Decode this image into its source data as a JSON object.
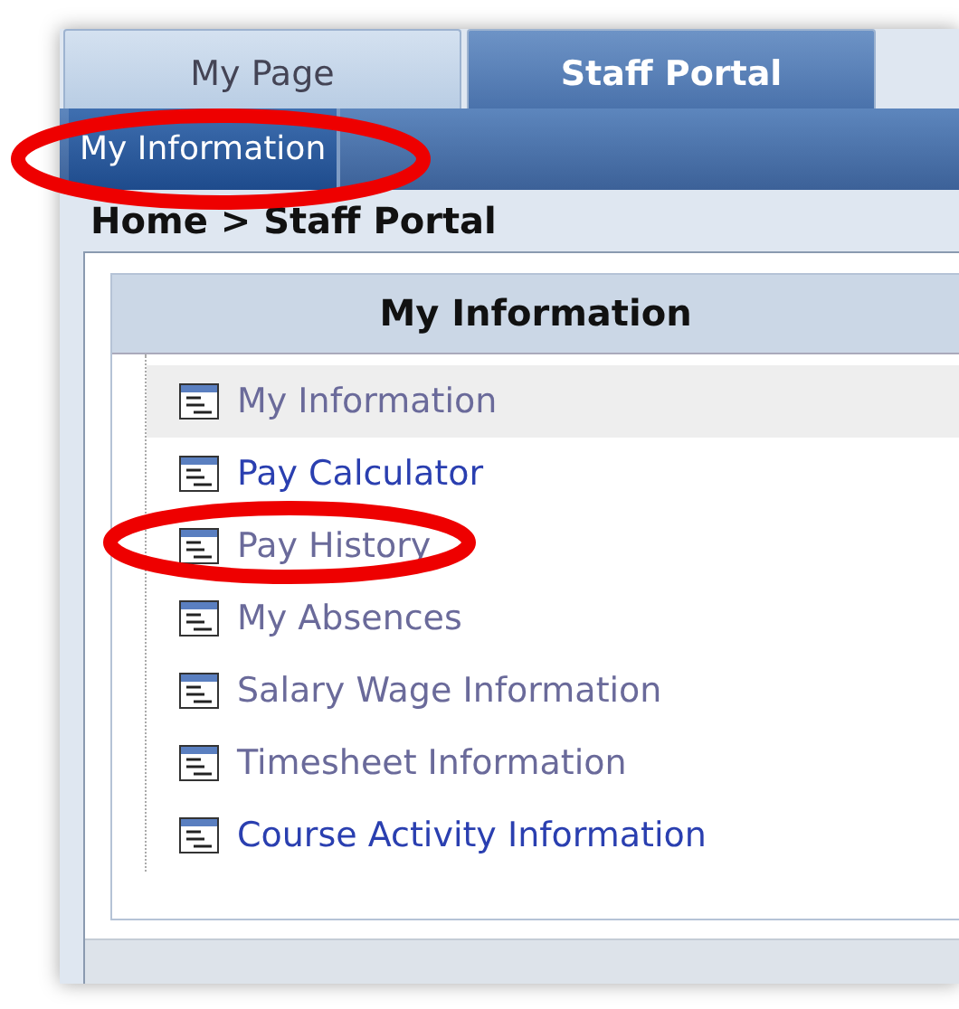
{
  "tabs": [
    {
      "label": "My Page",
      "selected": false
    },
    {
      "label": "Staff Portal",
      "selected": true
    }
  ],
  "subnav": [
    {
      "label": "My Information",
      "selected": true
    }
  ],
  "breadcrumb": "Home > Staff Portal",
  "panel": {
    "title": "My Information",
    "items": [
      {
        "label": "My Information",
        "selected": true,
        "visited": true
      },
      {
        "label": "Pay Calculator",
        "selected": false,
        "visited": false
      },
      {
        "label": "Pay History",
        "selected": false,
        "visited": true
      },
      {
        "label": "My Absences",
        "selected": false,
        "visited": true
      },
      {
        "label": "Salary Wage Information",
        "selected": false,
        "visited": true
      },
      {
        "label": "Timesheet Information",
        "selected": false,
        "visited": true
      },
      {
        "label": "Course Activity Information",
        "selected": false,
        "visited": false
      }
    ]
  }
}
